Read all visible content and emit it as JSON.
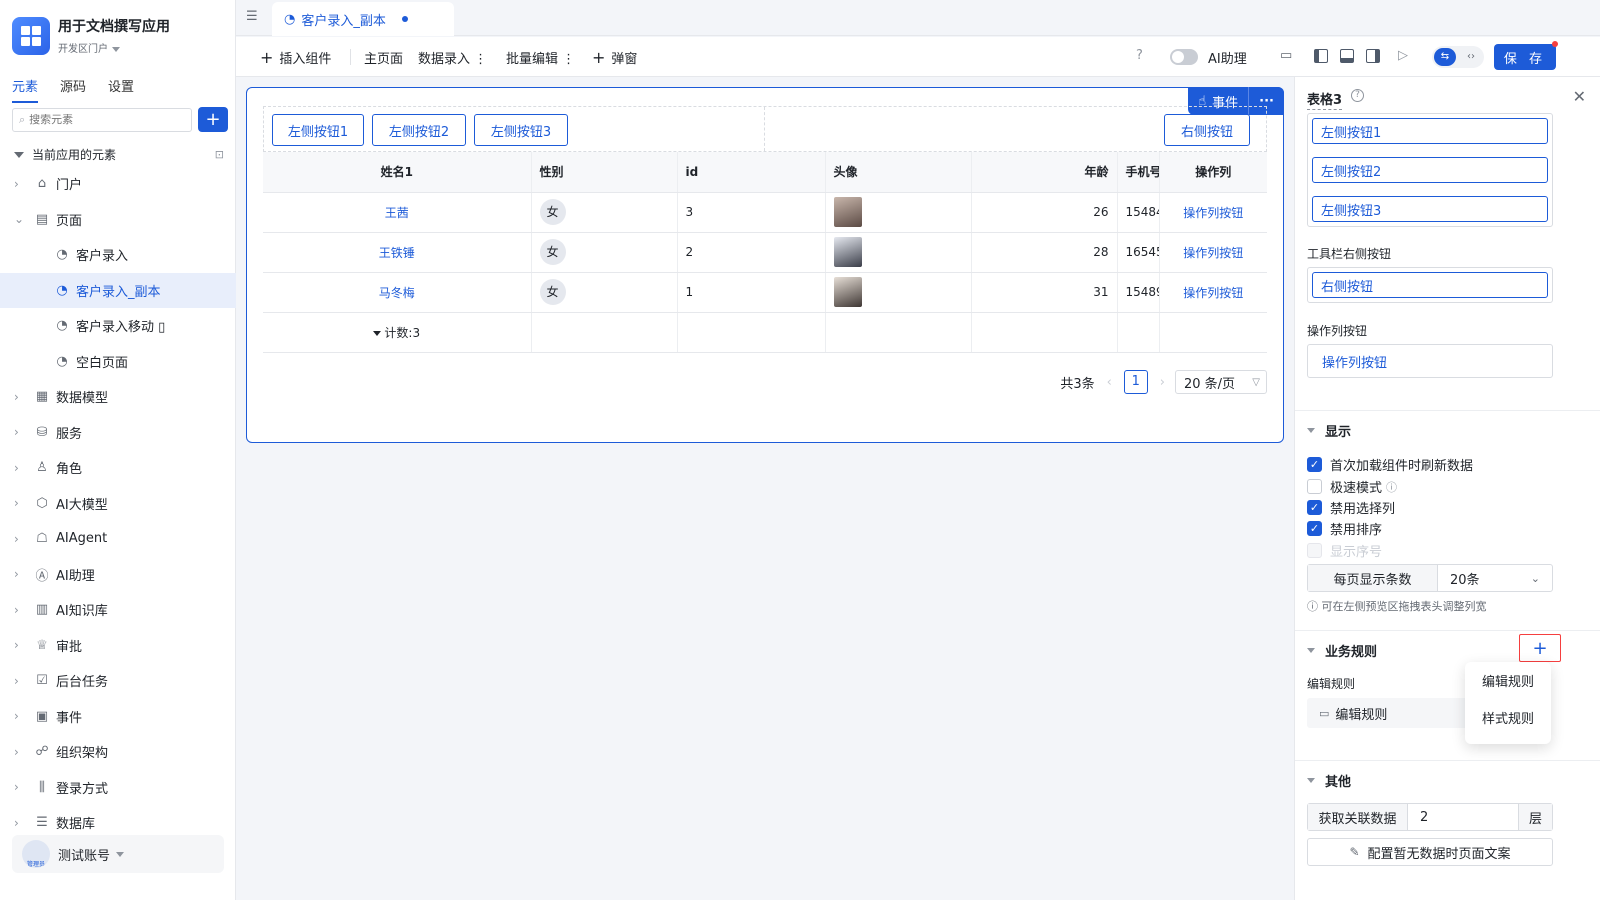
{
  "app": {
    "title": "用于文档撰写应用",
    "env": "开发区门户"
  },
  "sidebar": {
    "tabs": [
      "元素",
      "源码",
      "设置"
    ],
    "active_tab": 0,
    "search_placeholder": "搜索元素",
    "tree_header": "当前应用的元素",
    "items": [
      {
        "label": "门户",
        "icon": "home-icon",
        "level": 0,
        "expanded": false
      },
      {
        "label": "页面",
        "icon": "pages-icon",
        "level": 0,
        "expanded": true
      },
      {
        "label": "客户录入",
        "icon": "page-icon",
        "level": 1
      },
      {
        "label": "客户录入_副本",
        "icon": "page-icon",
        "level": 1,
        "selected": true
      },
      {
        "label": "客户录入移动",
        "icon": "page-icon",
        "level": 1,
        "mobile": true
      },
      {
        "label": "空白页面",
        "icon": "page-icon",
        "level": 1
      },
      {
        "label": "数据模型",
        "icon": "table-icon",
        "level": 0
      },
      {
        "label": "服务",
        "icon": "service-icon",
        "level": 0
      },
      {
        "label": "角色",
        "icon": "role-icon",
        "level": 0
      },
      {
        "label": "AI大模型",
        "icon": "model-icon",
        "level": 0
      },
      {
        "label": "AIAgent",
        "icon": "robot-icon",
        "level": 0
      },
      {
        "label": "AI助理",
        "icon": "ai-assistant-icon",
        "level": 0
      },
      {
        "label": "AI知识库",
        "icon": "book-icon",
        "level": 0
      },
      {
        "label": "审批",
        "icon": "stamp-icon",
        "level": 0
      },
      {
        "label": "后台任务",
        "icon": "task-icon",
        "level": 0
      },
      {
        "label": "事件",
        "icon": "event-icon",
        "level": 0
      },
      {
        "label": "组织架构",
        "icon": "org-icon",
        "level": 0
      },
      {
        "label": "登录方式",
        "icon": "login-icon",
        "level": 0
      },
      {
        "label": "数据库",
        "icon": "database-icon",
        "level": 0
      }
    ],
    "user": {
      "name": "测试账号",
      "role": "管理员"
    }
  },
  "tabbar": {
    "active_tab": "客户录入_副本"
  },
  "toolbar": {
    "insert": "插入组件",
    "main_page": "主页面",
    "data_entry": "数据录入",
    "batch_edit": "批量编辑",
    "popup": "弹窗",
    "ai_assistant": "AI助理",
    "save": "保 存"
  },
  "canvas": {
    "event_label": "事件",
    "left_buttons": [
      "左侧按钮1",
      "左侧按钮2",
      "左侧按钮3"
    ],
    "right_button": "右侧按钮",
    "columns": [
      "姓名1",
      "性别",
      "id",
      "头像",
      "年龄",
      "手机号",
      "操作列"
    ],
    "rows": [
      {
        "name": "王茜",
        "gender": "女",
        "id": "3",
        "age": "26",
        "phone": "15484",
        "action": "操作列按钮"
      },
      {
        "name": "王铁锤",
        "gender": "女",
        "id": "2",
        "age": "28",
        "phone": "16545",
        "action": "操作列按钮"
      },
      {
        "name": "马冬梅",
        "gender": "女",
        "id": "1",
        "age": "31",
        "phone": "15489",
        "action": "操作列按钮"
      }
    ],
    "count_label": "计数:3",
    "pager": {
      "total": "共3条",
      "page": "1",
      "size": "20 条/页"
    }
  },
  "panel": {
    "title": "表格3",
    "left_buttons": [
      "左侧按钮1",
      "左侧按钮2",
      "左侧按钮3"
    ],
    "toolbar_right_label": "工具栏右侧按钮",
    "toolbar_right_button": "右侧按钮",
    "action_col_label": "操作列按钮",
    "action_col_button": "操作列按钮",
    "display_section": "显示",
    "checks": [
      {
        "label": "首次加载组件时刷新数据",
        "checked": true,
        "disabled": false,
        "info": false
      },
      {
        "label": "极速模式",
        "checked": false,
        "disabled": false,
        "info": true
      },
      {
        "label": "禁用选择列",
        "checked": true,
        "disabled": false,
        "info": false
      },
      {
        "label": "禁用排序",
        "checked": true,
        "disabled": false,
        "info": false
      },
      {
        "label": "显示序号",
        "checked": false,
        "disabled": true,
        "info": false
      }
    ],
    "page_size_label": "每页显示条数",
    "page_size_value": "20条",
    "hint": "可在左侧预览区拖拽表头调整列宽",
    "rules_section": "业务规则",
    "edit_rule_label": "编辑规则",
    "edit_rule_button": "编辑规则",
    "rule_menu": [
      "编辑规则",
      "样式规则"
    ],
    "other_section": "其他",
    "related_label": "获取关联数据",
    "related_value": "2",
    "related_unit": "层",
    "empty_text_button": "配置暂无数据时页面文案"
  }
}
